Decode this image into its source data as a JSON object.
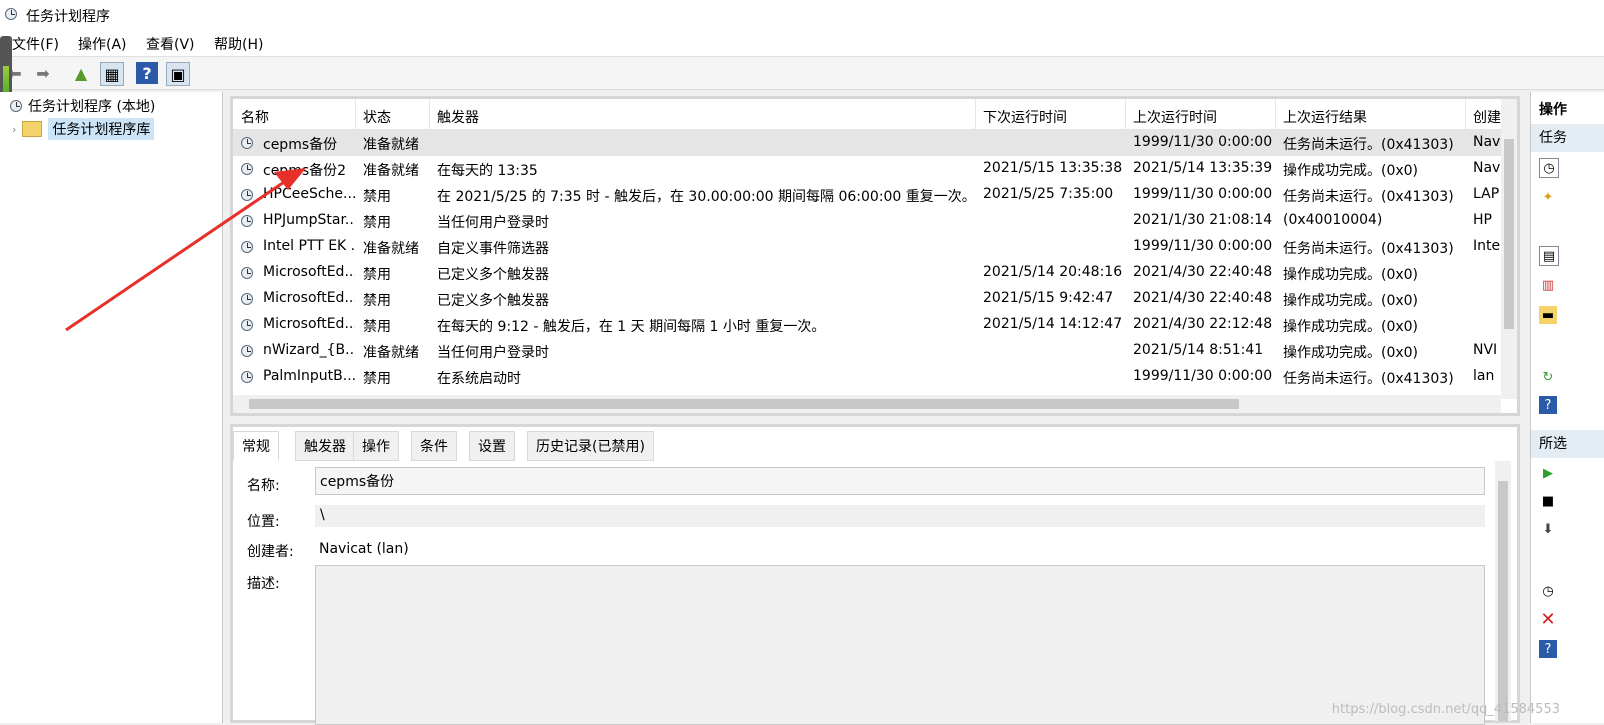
{
  "window": {
    "title": "任务计划程序"
  },
  "menu": [
    "文件(F)",
    "操作(A)",
    "查看(V)",
    "帮助(H)"
  ],
  "tree": {
    "root": "任务计划程序 (本地)",
    "child": "任务计划程序库"
  },
  "table": {
    "columns": [
      "名称",
      "状态",
      "触发器",
      "下次运行时间",
      "上次运行时间",
      "上次运行结果",
      "创建"
    ],
    "rows": [
      [
        "cepms备份",
        "准备就绪",
        "",
        "",
        "1999/11/30 0:00:00",
        "任务尚未运行。(0x41303)",
        "Nav"
      ],
      [
        "cepms备份2",
        "准备就绪",
        "在每天的 13:35",
        "2021/5/15 13:35:38",
        "2021/5/14 13:35:39",
        "操作成功完成。(0x0)",
        "Nav"
      ],
      [
        "HPCeeSche...",
        "禁用",
        "在 2021/5/25 的 7:35 时 - 触发后，在 30.00:00:00 期间每隔 06:00:00 重复一次。",
        "2021/5/25 7:35:00",
        "1999/11/30 0:00:00",
        "任务尚未运行。(0x41303)",
        "LAP"
      ],
      [
        "HPJumpStar...",
        "禁用",
        "当任何用户登录时",
        "",
        "2021/1/30 21:08:14",
        "(0x40010004)",
        "HP"
      ],
      [
        "Intel PTT EK ...",
        "准备就绪",
        "自定义事件筛选器",
        "",
        "1999/11/30 0:00:00",
        "任务尚未运行。(0x41303)",
        "Inte"
      ],
      [
        "MicrosoftEd...",
        "禁用",
        "已定义多个触发器",
        "2021/5/14 20:48:16",
        "2021/4/30 22:40:48",
        "操作成功完成。(0x0)",
        ""
      ],
      [
        "MicrosoftEd...",
        "禁用",
        "已定义多个触发器",
        "2021/5/15 9:42:47",
        "2021/4/30 22:40:48",
        "操作成功完成。(0x0)",
        ""
      ],
      [
        "MicrosoftEd...",
        "禁用",
        "在每天的 9:12 - 触发后，在 1 天 期间每隔 1 小时 重复一次。",
        "2021/5/14 14:12:47",
        "2021/4/30 22:12:48",
        "操作成功完成。(0x0)",
        ""
      ],
      [
        "nWizard_{B...",
        "准备就绪",
        "当任何用户登录时",
        "",
        "2021/5/14 8:51:41",
        "操作成功完成。(0x0)",
        "NVI"
      ],
      [
        "PalmInputB...",
        "禁用",
        "在系统启动时",
        "",
        "1999/11/30 0:00:00",
        "任务尚未运行。(0x41303)",
        "lan"
      ]
    ]
  },
  "details": {
    "tabs": [
      "常规",
      "触发器",
      "操作",
      "条件",
      "设置",
      "历史记录(已禁用)"
    ],
    "name_label": "名称:",
    "name_value": "cepms备份",
    "location_label": "位置:",
    "location_value": "\\",
    "author_label": "创建者:",
    "author_value": "Navicat (lan)",
    "desc_label": "描述:"
  },
  "actions": {
    "header1": "操作",
    "header2": "任务",
    "header3": "所选"
  },
  "watermark": "https://blog.csdn.net/qq_41584553",
  "colors": {
    "arrow": "#e8302a",
    "selected_row": "#e5e5e5",
    "action_header": "#e4ecf4"
  }
}
